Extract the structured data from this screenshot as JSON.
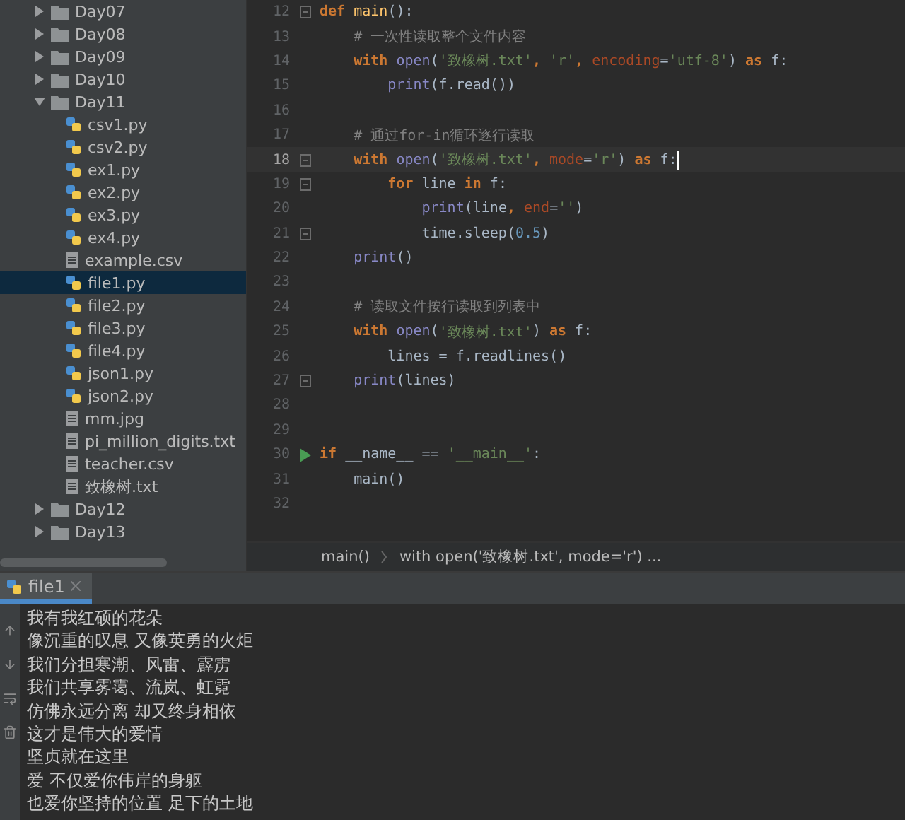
{
  "project_tree": [
    {
      "kind": "folder",
      "label": "Day07",
      "expanded": false
    },
    {
      "kind": "folder",
      "label": "Day08",
      "expanded": false
    },
    {
      "kind": "folder",
      "label": "Day09",
      "expanded": false
    },
    {
      "kind": "folder",
      "label": "Day10",
      "expanded": false
    },
    {
      "kind": "folder",
      "label": "Day11",
      "expanded": true,
      "children": [
        {
          "kind": "python",
          "label": "csv1.py",
          "selected": false
        },
        {
          "kind": "python",
          "label": "csv2.py",
          "selected": false
        },
        {
          "kind": "python",
          "label": "ex1.py",
          "selected": false
        },
        {
          "kind": "python",
          "label": "ex2.py",
          "selected": false
        },
        {
          "kind": "python",
          "label": "ex3.py",
          "selected": false
        },
        {
          "kind": "python",
          "label": "ex4.py",
          "selected": false
        },
        {
          "kind": "text",
          "label": "example.csv",
          "selected": false
        },
        {
          "kind": "python",
          "label": "file1.py",
          "selected": true
        },
        {
          "kind": "python",
          "label": "file2.py",
          "selected": false
        },
        {
          "kind": "python",
          "label": "file3.py",
          "selected": false
        },
        {
          "kind": "python",
          "label": "file4.py",
          "selected": false
        },
        {
          "kind": "python",
          "label": "json1.py",
          "selected": false
        },
        {
          "kind": "python",
          "label": "json2.py",
          "selected": false
        },
        {
          "kind": "image",
          "label": "mm.jpg",
          "selected": false
        },
        {
          "kind": "text",
          "label": "pi_million_digits.txt",
          "selected": false
        },
        {
          "kind": "text",
          "label": "teacher.csv",
          "selected": false
        },
        {
          "kind": "text",
          "label": "致橡树.txt",
          "selected": false
        }
      ]
    },
    {
      "kind": "folder",
      "label": "Day12",
      "expanded": false
    },
    {
      "kind": "folder",
      "label": "Day13",
      "expanded": false
    }
  ],
  "editor": {
    "lines": [
      {
        "number": "12",
        "current": false,
        "kind": "fold",
        "tokens": [
          {
            "kind": "keyword",
            "text": "def "
          },
          {
            "kind": "name",
            "text": "main"
          },
          {
            "kind": "plain",
            "text": "():"
          }
        ]
      },
      {
        "number": "13",
        "current": false,
        "tokens": [
          {
            "kind": "comment",
            "text": "    # 一次性读取整个文件内容"
          }
        ]
      },
      {
        "number": "14",
        "current": false,
        "tokens": [
          {
            "kind": "keyword",
            "text": "    with "
          },
          {
            "kind": "builtin",
            "text": "open"
          },
          {
            "kind": "plain",
            "text": "("
          },
          {
            "kind": "string",
            "text": "'致橡树.txt'"
          },
          {
            "kind": "keyword",
            "text": ", "
          },
          {
            "kind": "string",
            "text": "'r'"
          },
          {
            "kind": "keyword",
            "text": ", "
          },
          {
            "kind": "param",
            "text": "encoding"
          },
          {
            "kind": "plain",
            "text": "="
          },
          {
            "kind": "string",
            "text": "'utf-8'"
          },
          {
            "kind": "plain",
            "text": ") "
          },
          {
            "kind": "keyword",
            "text": "as "
          },
          {
            "kind": "plain",
            "text": "f:"
          }
        ]
      },
      {
        "number": "15",
        "current": false,
        "tokens": [
          {
            "kind": "builtin",
            "text": "        print"
          },
          {
            "kind": "plain",
            "text": "(f.read())"
          }
        ]
      },
      {
        "number": "16",
        "current": false
      },
      {
        "number": "17",
        "current": false,
        "tokens": [
          {
            "kind": "comment",
            "text": "    # 通过for-in循环逐行读取"
          }
        ]
      },
      {
        "number": "18",
        "current": true,
        "kind": "fold",
        "tokens": [
          {
            "kind": "keyword",
            "text": "    with "
          },
          {
            "kind": "builtin",
            "text": "open"
          },
          {
            "kind": "plain",
            "text": "("
          },
          {
            "kind": "string",
            "text": "'致橡树.txt'"
          },
          {
            "kind": "keyword",
            "text": ", "
          },
          {
            "kind": "param",
            "text": "mode"
          },
          {
            "kind": "plain",
            "text": "="
          },
          {
            "kind": "string",
            "text": "'r'"
          },
          {
            "kind": "plain",
            "text": ") "
          },
          {
            "kind": "keyword",
            "text": "as "
          },
          {
            "kind": "plain",
            "text": "f:"
          }
        ]
      },
      {
        "number": "19",
        "current": false,
        "kind": "fold",
        "tokens": [
          {
            "kind": "keyword",
            "text": "        for "
          },
          {
            "kind": "plain",
            "text": "line "
          },
          {
            "kind": "keyword",
            "text": "in "
          },
          {
            "kind": "plain",
            "text": "f:"
          }
        ]
      },
      {
        "number": "20",
        "current": false,
        "tokens": [
          {
            "kind": "builtin",
            "text": "            print"
          },
          {
            "kind": "plain",
            "text": "(line"
          },
          {
            "kind": "keyword",
            "text": ", "
          },
          {
            "kind": "param",
            "text": "end"
          },
          {
            "kind": "plain",
            "text": "="
          },
          {
            "kind": "string",
            "text": "''"
          },
          {
            "kind": "plain",
            "text": ")"
          }
        ]
      },
      {
        "number": "21",
        "current": false,
        "kind": "fold",
        "tokens": [
          {
            "kind": "plain",
            "text": "            time.sleep("
          },
          {
            "kind": "number",
            "text": "0.5"
          },
          {
            "kind": "plain",
            "text": ")"
          }
        ]
      },
      {
        "number": "22",
        "current": false,
        "tokens": [
          {
            "kind": "builtin",
            "text": "    print"
          },
          {
            "kind": "plain",
            "text": "()"
          }
        ]
      },
      {
        "number": "23",
        "current": false
      },
      {
        "number": "24",
        "current": false,
        "tokens": [
          {
            "kind": "comment",
            "text": "    # 读取文件按行读取到列表中"
          }
        ]
      },
      {
        "number": "25",
        "current": false,
        "tokens": [
          {
            "kind": "keyword",
            "text": "    with "
          },
          {
            "kind": "builtin",
            "text": "open"
          },
          {
            "kind": "plain",
            "text": "("
          },
          {
            "kind": "string",
            "text": "'致橡树.txt'"
          },
          {
            "kind": "plain",
            "text": ") "
          },
          {
            "kind": "keyword",
            "text": "as "
          },
          {
            "kind": "plain",
            "text": "f:"
          }
        ]
      },
      {
        "number": "26",
        "current": false,
        "tokens": [
          {
            "kind": "plain",
            "text": "        lines = f.readlines()"
          }
        ]
      },
      {
        "number": "27",
        "current": false,
        "kind": "fold",
        "tokens": [
          {
            "kind": "builtin",
            "text": "    print"
          },
          {
            "kind": "plain",
            "text": "(lines)"
          }
        ]
      },
      {
        "number": "28",
        "current": false
      },
      {
        "number": "29",
        "current": false
      },
      {
        "number": "30",
        "current": false,
        "kind": "run",
        "tokens": [
          {
            "kind": "keyword",
            "text": "if "
          },
          {
            "kind": "plain",
            "text": "__name__ == "
          },
          {
            "kind": "string",
            "text": "'__main__'"
          },
          {
            "kind": "plain",
            "text": ":"
          }
        ]
      },
      {
        "number": "31",
        "current": false,
        "tokens": [
          {
            "kind": "plain",
            "text": "    main()"
          }
        ]
      },
      {
        "number": "32",
        "current": false
      }
    ],
    "breadcrumbs": [
      "main()",
      "with open('致橡树.txt', mode='r') ..."
    ]
  },
  "run_panel": {
    "tabs": [
      {
        "label": "file1",
        "selected": true
      }
    ],
    "output": [
      "我有我红硕的花朵",
      "像沉重的叹息 又像英勇的火炬",
      "我们分担寒潮、风雷、霹雳",
      "我们共享雾霭、流岚、虹霓",
      "仿佛永远分离 却又终身相依",
      "这才是伟大的爱情",
      "坚贞就在这里",
      "爱 不仅爱你伟岸的身躯",
      "也爱你坚持的位置 足下的土地"
    ]
  }
}
